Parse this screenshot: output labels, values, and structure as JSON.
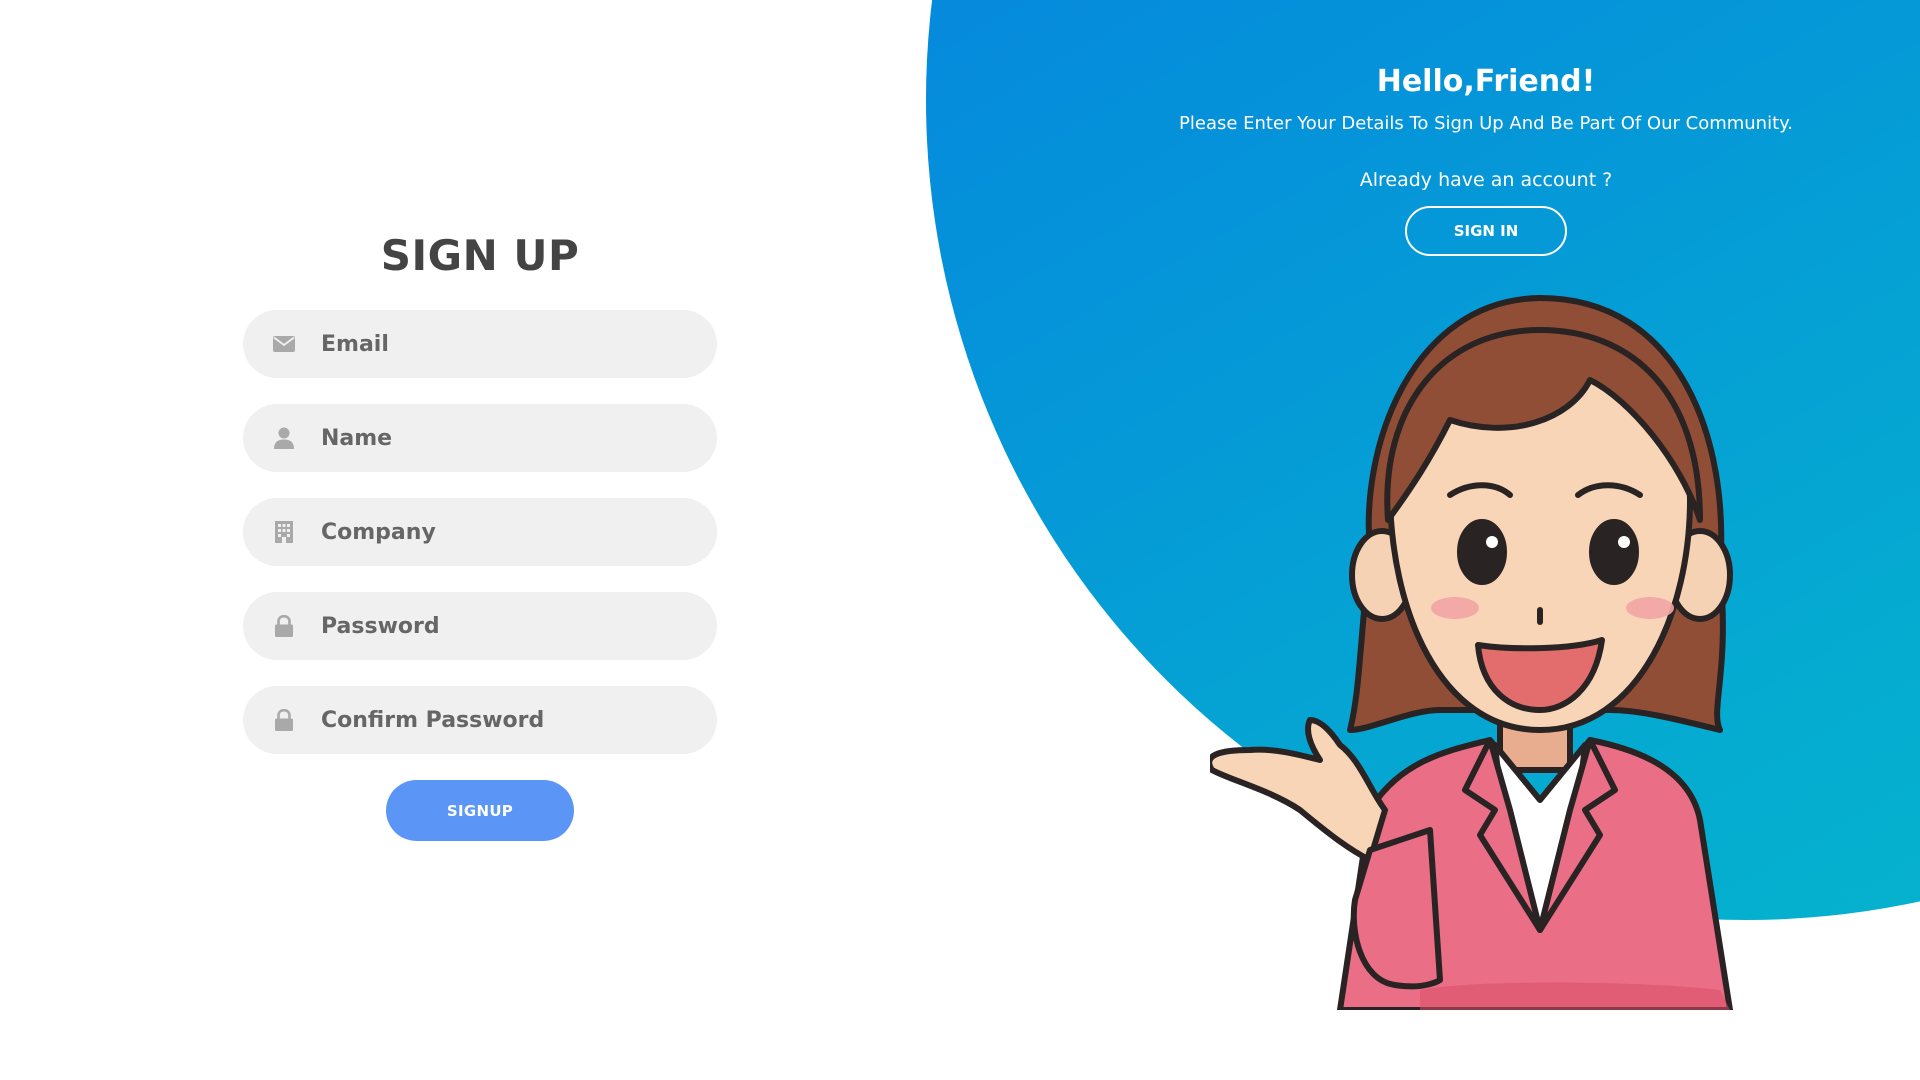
{
  "signup": {
    "title": "SIGN UP",
    "fields": [
      {
        "icon": "envelope-icon",
        "placeholder": "Email",
        "value": ""
      },
      {
        "icon": "user-icon",
        "placeholder": "Name",
        "value": ""
      },
      {
        "icon": "building-icon",
        "placeholder": "Company",
        "value": ""
      },
      {
        "icon": "lock-icon",
        "placeholder": "Password",
        "value": ""
      },
      {
        "icon": "lock-icon",
        "placeholder": "Confirm Password",
        "value": ""
      }
    ],
    "submit_label": "SIGNUP"
  },
  "welcome": {
    "title": "Hello,Friend!",
    "subtitle": "Please Enter Your Details To Sign Up And Be Part Of Our Community.",
    "question": "Already have an account ?",
    "signin_label": "SIGN IN"
  },
  "colors": {
    "gradient_start": "#0777e0",
    "gradient_end": "#06b9cb",
    "primary_button": "#5b95f5",
    "input_background": "#f0f0f0",
    "title_text": "#444444"
  }
}
